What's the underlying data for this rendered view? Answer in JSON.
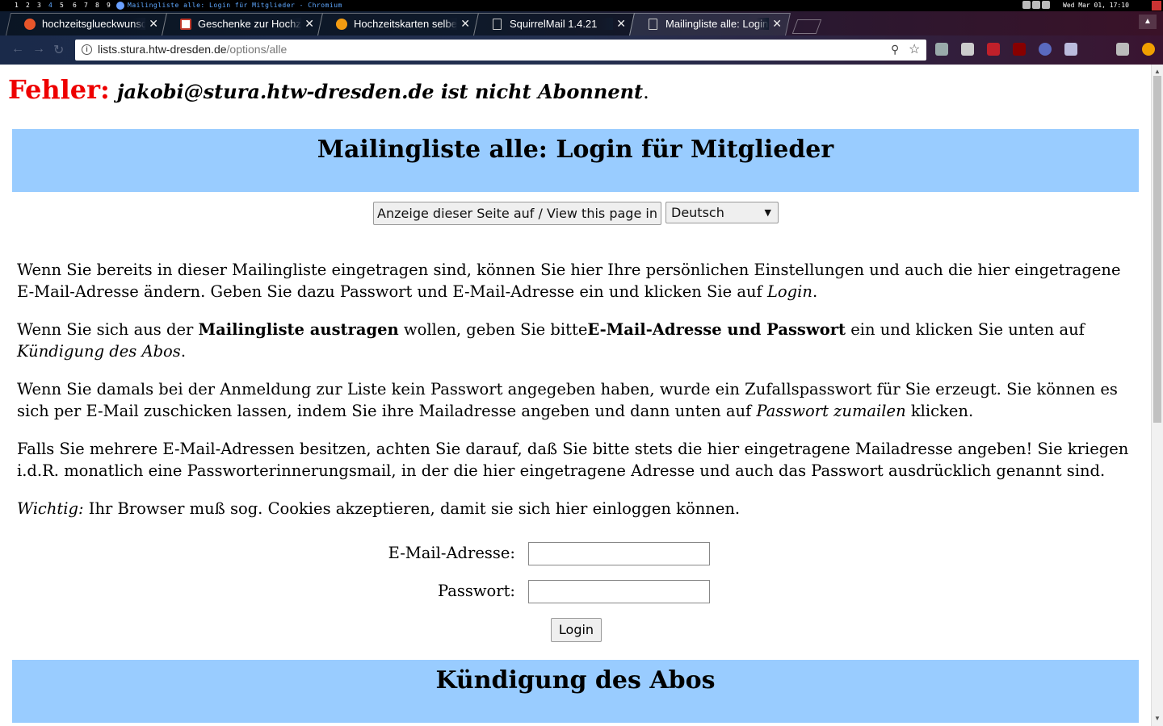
{
  "wm": {
    "workspaces": [
      "1",
      "2",
      "3",
      "4",
      "5",
      "6",
      "7",
      "8",
      "9"
    ],
    "window_title": "Mailingliste alle: Login für Mitglieder - Chromium",
    "clock": "Wed Mar 01, 17:10"
  },
  "tabs": [
    {
      "label": "hochzeitsglueckwunsc",
      "favicon_color": "#e8562a"
    },
    {
      "label": "Geschenke zur Hochze",
      "favicon_color": "#c0392b"
    },
    {
      "label": "Hochzeitskarten selbe",
      "favicon_color": "#f39c12"
    },
    {
      "label": "SquirrelMail 1.4.21",
      "favicon_color": "#cccccc"
    },
    {
      "label": "Mailingliste alle: Login",
      "favicon_color": "#cccccc"
    }
  ],
  "toolbar": {
    "url_host": "lists.stura.htw-dresden.de",
    "url_path": "/options/alle"
  },
  "page": {
    "error_label": "Fehler:",
    "error_message": "jakobi@stura.htw-dresden.de ist nicht Abonnent",
    "error_period": ".",
    "login_heading": "Mailingliste alle: Login für Mitglieder",
    "language_button": "Anzeige dieser Seite auf / View this page in",
    "language_selected": "Deutsch",
    "p1_text": "Wenn Sie bereits in dieser Mailingliste eingetragen sind, können Sie hier Ihre persönlichen Einstellungen und auch die hier eingetragene E-Mail-Adresse ändern. Geben Sie dazu Passwort und E-Mail-Adresse ein und klicken Sie auf ",
    "p1_em": "Login",
    "p1_end": ".",
    "p2_a": "Wenn Sie sich aus der ",
    "p2_b": "Mailingliste austragen",
    "p2_c": " wollen, geben Sie bitte",
    "p2_d": "E-Mail-Adresse und Passwort",
    "p2_e": " ein und klicken Sie unten auf ",
    "p2_f": "Kündigung des Abos",
    "p2_g": ".",
    "p3_a": "Wenn Sie damals bei der Anmeldung zur Liste kein Passwort angegeben haben, wurde ein Zufallspasswort für Sie erzeugt. Sie können es sich per E-Mail zuschicken lassen, indem Sie ihre Mailadresse angeben und dann unten auf ",
    "p3_b": "Passwort zumailen",
    "p3_c": " klicken.",
    "p4_text": "Falls Sie mehrere E-Mail-Adressen besitzen, achten Sie darauf, daß Sie bitte stets die hier eingetragene Mailadresse angeben! Sie kriegen i.d.R. monatlich eine Passworterinnerungsmail, in der die hier eingetragene Adresse und auch das Passwort ausdrücklich genannt sind.",
    "p5_a": "Wichtig:",
    "p5_b": " Ihr Browser muß sog. Cookies akzeptieren, damit sie sich hier einloggen können.",
    "email_label": "E-Mail-Adresse:",
    "email_value": "",
    "password_label": "Passwort:",
    "password_value": "",
    "login_button": "Login",
    "unsub_heading": "Kündigung des Abos"
  },
  "colors": {
    "banner": "#99ccff",
    "error": "#ee0000"
  }
}
